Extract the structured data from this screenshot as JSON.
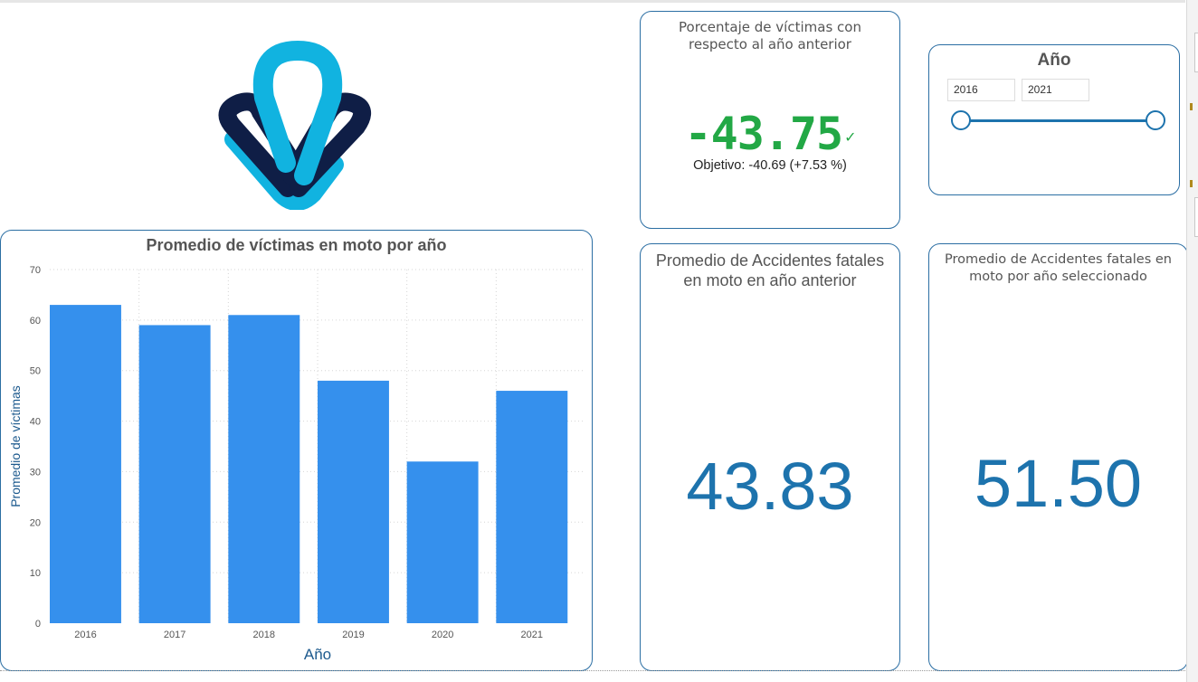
{
  "logo": {
    "name": "logo",
    "colors": {
      "light": "#11b3e0",
      "dark": "#0f1e46"
    }
  },
  "kpi_pct": {
    "title": "Porcentaje de víctimas con respecto al año anterior",
    "value": "-43.75",
    "status_icon": "check-icon",
    "target": "Objetivo: -40.69 (+7.53 %)",
    "color": "#22a845"
  },
  "slicer": {
    "title": "Año",
    "from": "2016",
    "to": "2021",
    "range": [
      2016,
      2021
    ]
  },
  "card_prev": {
    "title": "Promedio de Accidentes fatales en moto en año anterior",
    "value": "43.83"
  },
  "card_sel": {
    "title": "Promedio de Accidentes fatales en moto por año seleccionado",
    "value": "51.50"
  },
  "chart_data": {
    "type": "bar",
    "title": "Promedio de víctimas en moto por año",
    "xlabel": "Año",
    "ylabel": "Promedio de víctimas",
    "categories": [
      "2016",
      "2017",
      "2018",
      "2019",
      "2020",
      "2021"
    ],
    "values": [
      63,
      59,
      61,
      48,
      32,
      46
    ],
    "ylim": [
      0,
      70
    ],
    "yticks": [
      0,
      10,
      20,
      30,
      40,
      50,
      60,
      70
    ],
    "grid": true,
    "bar_color": "#3590ed"
  }
}
